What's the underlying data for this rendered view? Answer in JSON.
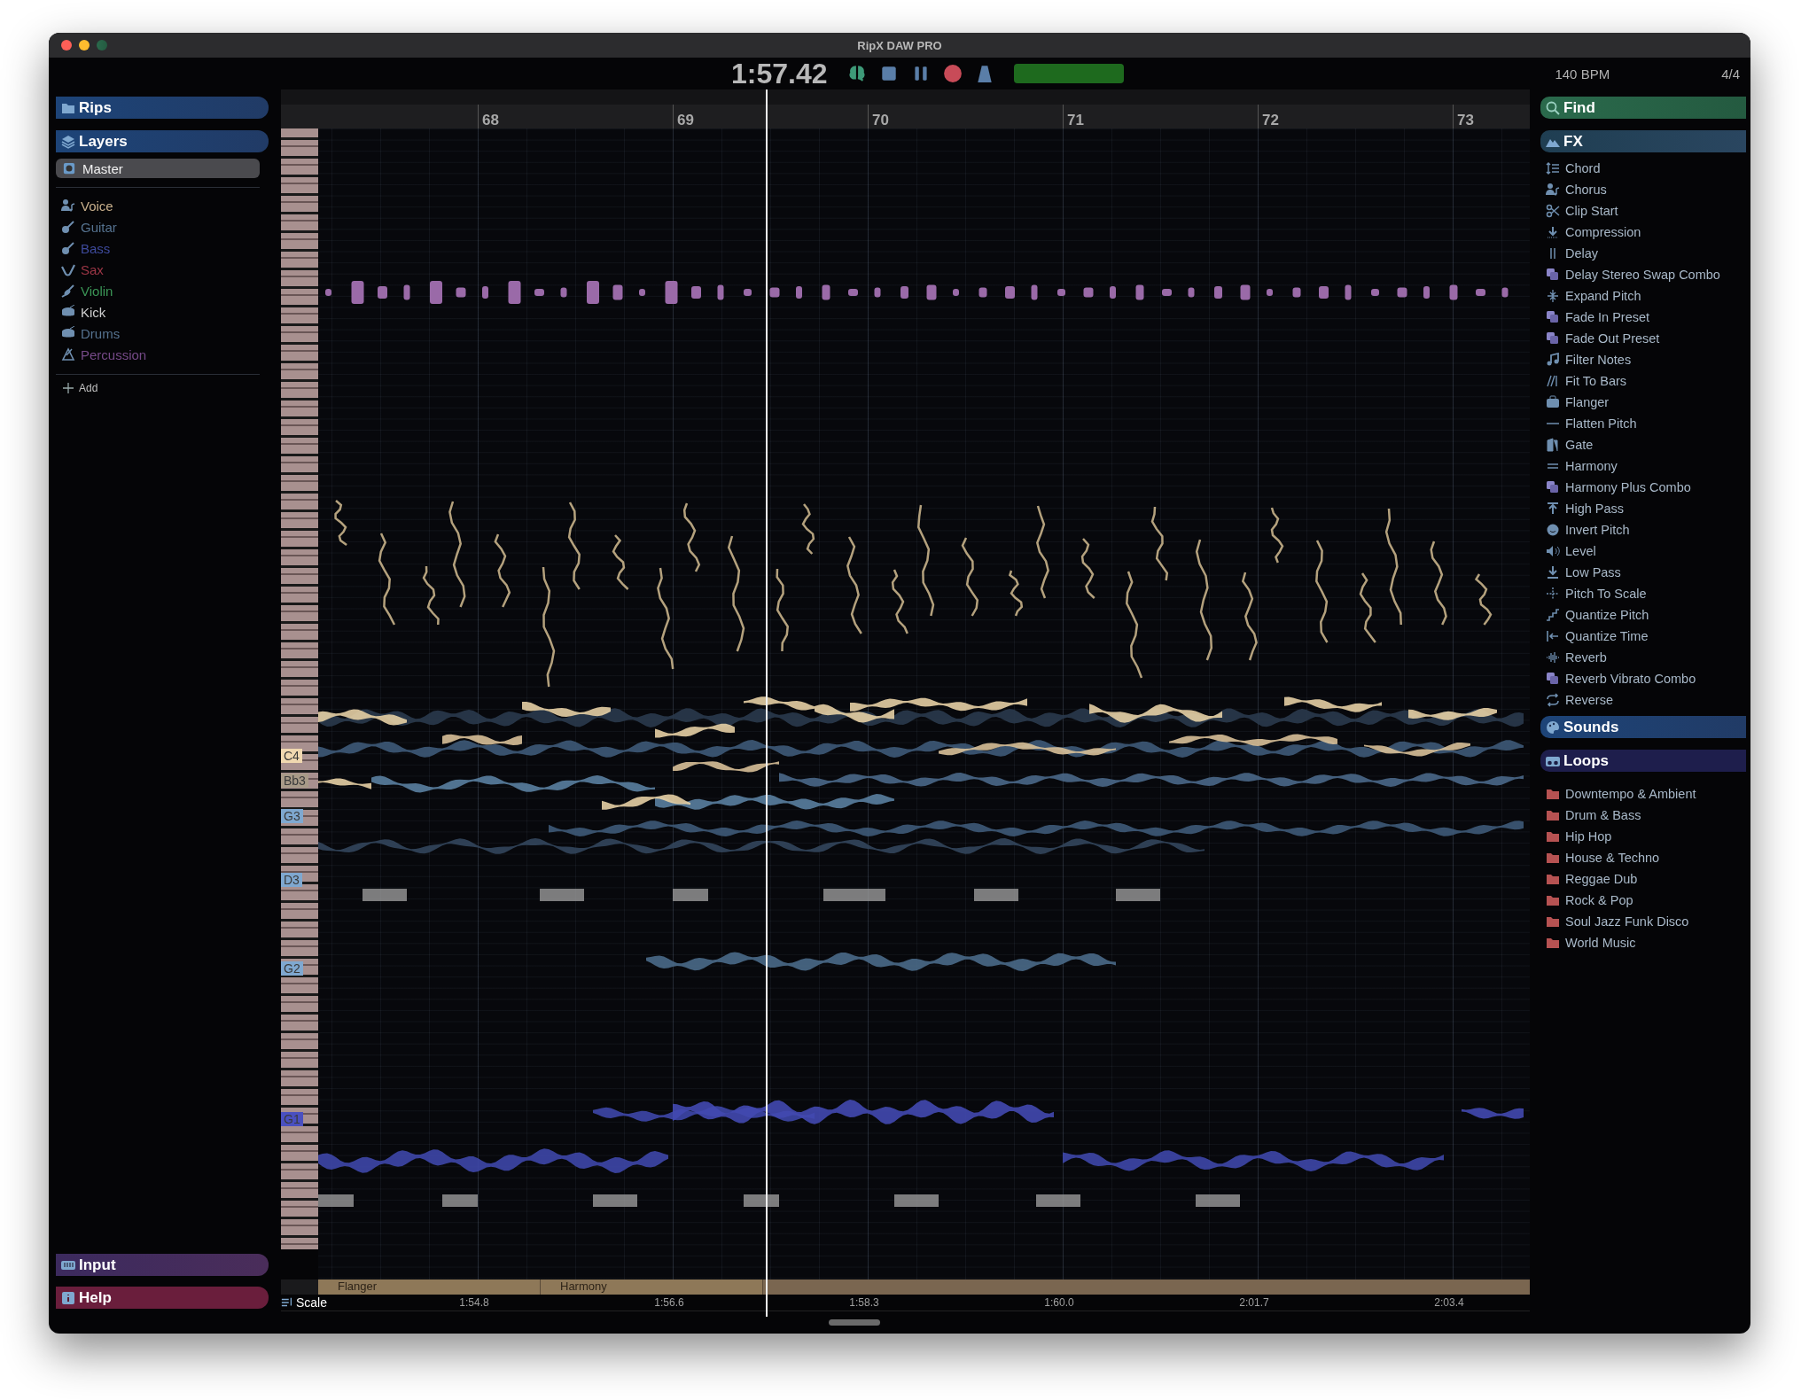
{
  "window": {
    "title": "RipX DAW PRO"
  },
  "transport": {
    "time": "1:57.42",
    "tempo": "140 BPM",
    "time_signature": "4/4"
  },
  "left_panel": {
    "rips": {
      "label": "Rips"
    },
    "layers": {
      "label": "Layers"
    },
    "master": {
      "label": "Master"
    },
    "layers_list": [
      {
        "name": "Voice",
        "color": "#c9b08c"
      },
      {
        "name": "Guitar",
        "color": "#55728f"
      },
      {
        "name": "Bass",
        "color": "#3e4a9c"
      },
      {
        "name": "Sax",
        "color": "#9c3646"
      },
      {
        "name": "Violin",
        "color": "#3b9556"
      },
      {
        "name": "Kick",
        "color": "#cfcfcf"
      },
      {
        "name": "Drums",
        "color": "#55728f"
      },
      {
        "name": "Percussion",
        "color": "#764a88"
      }
    ],
    "add": {
      "label": "Add"
    },
    "input": {
      "label": "Input"
    },
    "help": {
      "label": "Help"
    }
  },
  "ruler": {
    "bars": [
      "68",
      "69",
      "70",
      "71",
      "72",
      "73"
    ]
  },
  "piano_roll": {
    "note_labels": [
      "C4",
      "Bb3",
      "G3",
      "D3",
      "G2",
      "G1"
    ]
  },
  "clips": [
    {
      "label": "Flanger"
    },
    {
      "label": "Harmony"
    }
  ],
  "timeline": {
    "scale_label": "Scale",
    "times": [
      "1:54.8",
      "1:56.6",
      "1:58.3",
      "1:60.0",
      "2:01.7",
      "2:03.4"
    ]
  },
  "right_panel": {
    "find": {
      "label": "Find"
    },
    "fx": {
      "label": "FX",
      "items": [
        "Chord",
        "Chorus",
        "Clip Start",
        "Compression",
        "Delay",
        "Delay Stereo Swap Combo",
        "Expand Pitch",
        "Fade In Preset",
        "Fade Out Preset",
        "Filter Notes",
        "Fit To Bars",
        "Flanger",
        "Flatten Pitch",
        "Gate",
        "Harmony",
        "Harmony Plus Combo",
        "High Pass",
        "Invert Pitch",
        "Level",
        "Low Pass",
        "Pitch To Scale",
        "Quantize Pitch",
        "Quantize Time",
        "Reverb",
        "Reverb Vibrato Combo",
        "Reverse"
      ]
    },
    "sounds": {
      "label": "Sounds"
    },
    "loops": {
      "label": "Loops",
      "items": [
        "Downtempo & Ambient",
        "Drum & Bass",
        "Hip Hop",
        "House & Techno",
        "Reggae Dub",
        "Rock & Pop",
        "Soul Jazz Funk Disco",
        "World Music"
      ]
    }
  }
}
